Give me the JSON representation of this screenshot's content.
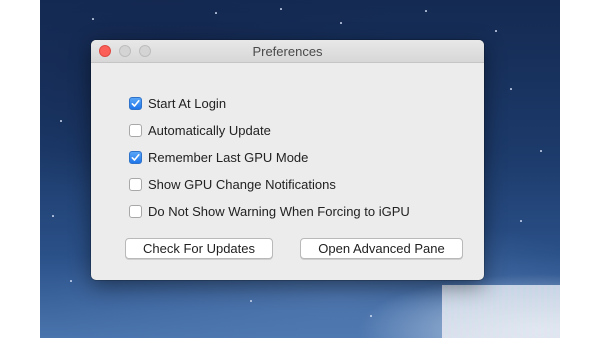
{
  "window": {
    "title": "Preferences"
  },
  "options": [
    {
      "label": "Start At Login",
      "checked": true
    },
    {
      "label": "Automatically Update",
      "checked": false
    },
    {
      "label": "Remember Last GPU Mode",
      "checked": true
    },
    {
      "label": "Show GPU Change Notifications",
      "checked": false
    },
    {
      "label": "Do Not Show Warning When Forcing to iGPU",
      "checked": false
    }
  ],
  "buttons": {
    "check_updates": "Check For Updates",
    "open_advanced": "Open Advanced Pane"
  },
  "colors": {
    "close_button": "#fc5f57",
    "checkbox_checked": "#1f76ea",
    "window_background": "#ececec"
  }
}
